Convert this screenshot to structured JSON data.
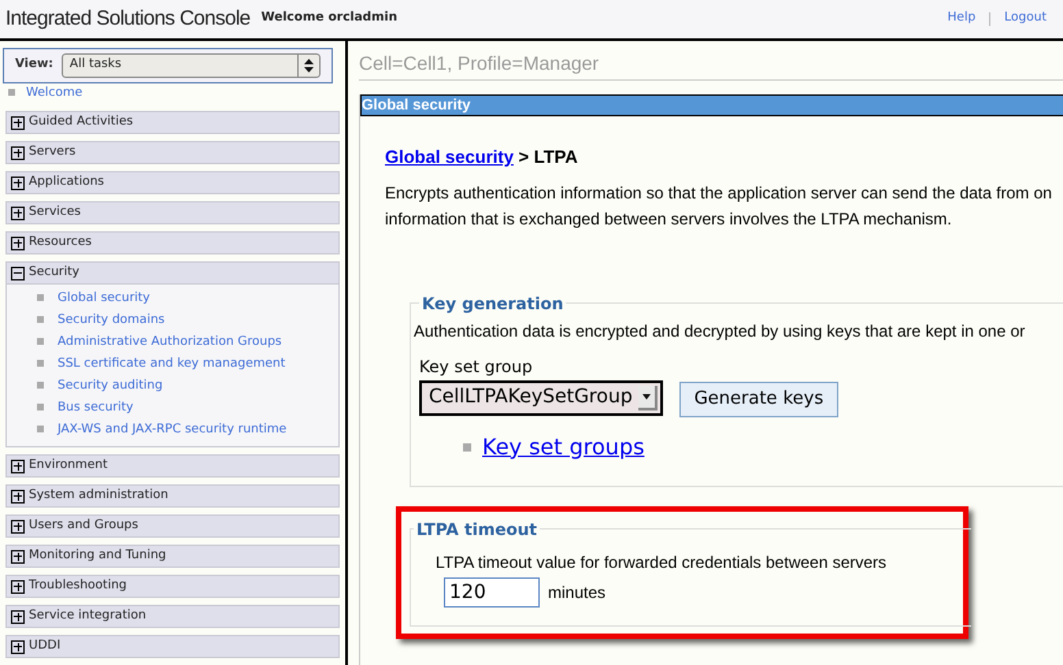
{
  "header": {
    "title": "Integrated Solutions Console",
    "welcome": "Welcome orcladmin",
    "links": [
      "Help",
      "Logout"
    ]
  },
  "sidebar": {
    "view_label": "View:",
    "view_value": "All tasks",
    "welcome_link": "Welcome",
    "sections": [
      {
        "label": "Guided Activities",
        "expanded": false
      },
      {
        "label": "Servers",
        "expanded": false
      },
      {
        "label": "Applications",
        "expanded": false
      },
      {
        "label": "Services",
        "expanded": false
      },
      {
        "label": "Resources",
        "expanded": false
      },
      {
        "label": "Security",
        "expanded": true,
        "children": [
          "Global security",
          "Security domains",
          "Administrative Authorization Groups",
          "SSL certificate and key management",
          "Security auditing",
          "Bus security",
          "JAX-WS and JAX-RPC security runtime"
        ]
      },
      {
        "label": "Environment",
        "expanded": false
      },
      {
        "label": "System administration",
        "expanded": false
      },
      {
        "label": "Users and Groups",
        "expanded": false
      },
      {
        "label": "Monitoring and Tuning",
        "expanded": false
      },
      {
        "label": "Troubleshooting",
        "expanded": false
      },
      {
        "label": "Service integration",
        "expanded": false
      },
      {
        "label": "UDDI",
        "expanded": false
      }
    ]
  },
  "content": {
    "scope": "Cell=Cell1, Profile=Manager",
    "panel_title": "Global security",
    "breadcrumb": {
      "link": "Global security",
      "current": "> LTPA"
    },
    "description": [
      "Encrypts authentication information so that the application server can send the data from on",
      "information that is exchanged between servers involves the LTPA mechanism."
    ],
    "key_generation": {
      "legend": "Key generation",
      "description": "Authentication data is encrypted and decrypted by using keys that are kept in one or",
      "field_label": "Key set group",
      "field_value": "CellLTPAKeySetGroup",
      "button": "Generate keys",
      "link": "Key set groups"
    },
    "ltpa_timeout": {
      "legend": "LTPA timeout",
      "label": "LTPA timeout value for forwarded credentials between servers",
      "value": "120",
      "unit": "minutes"
    }
  }
}
